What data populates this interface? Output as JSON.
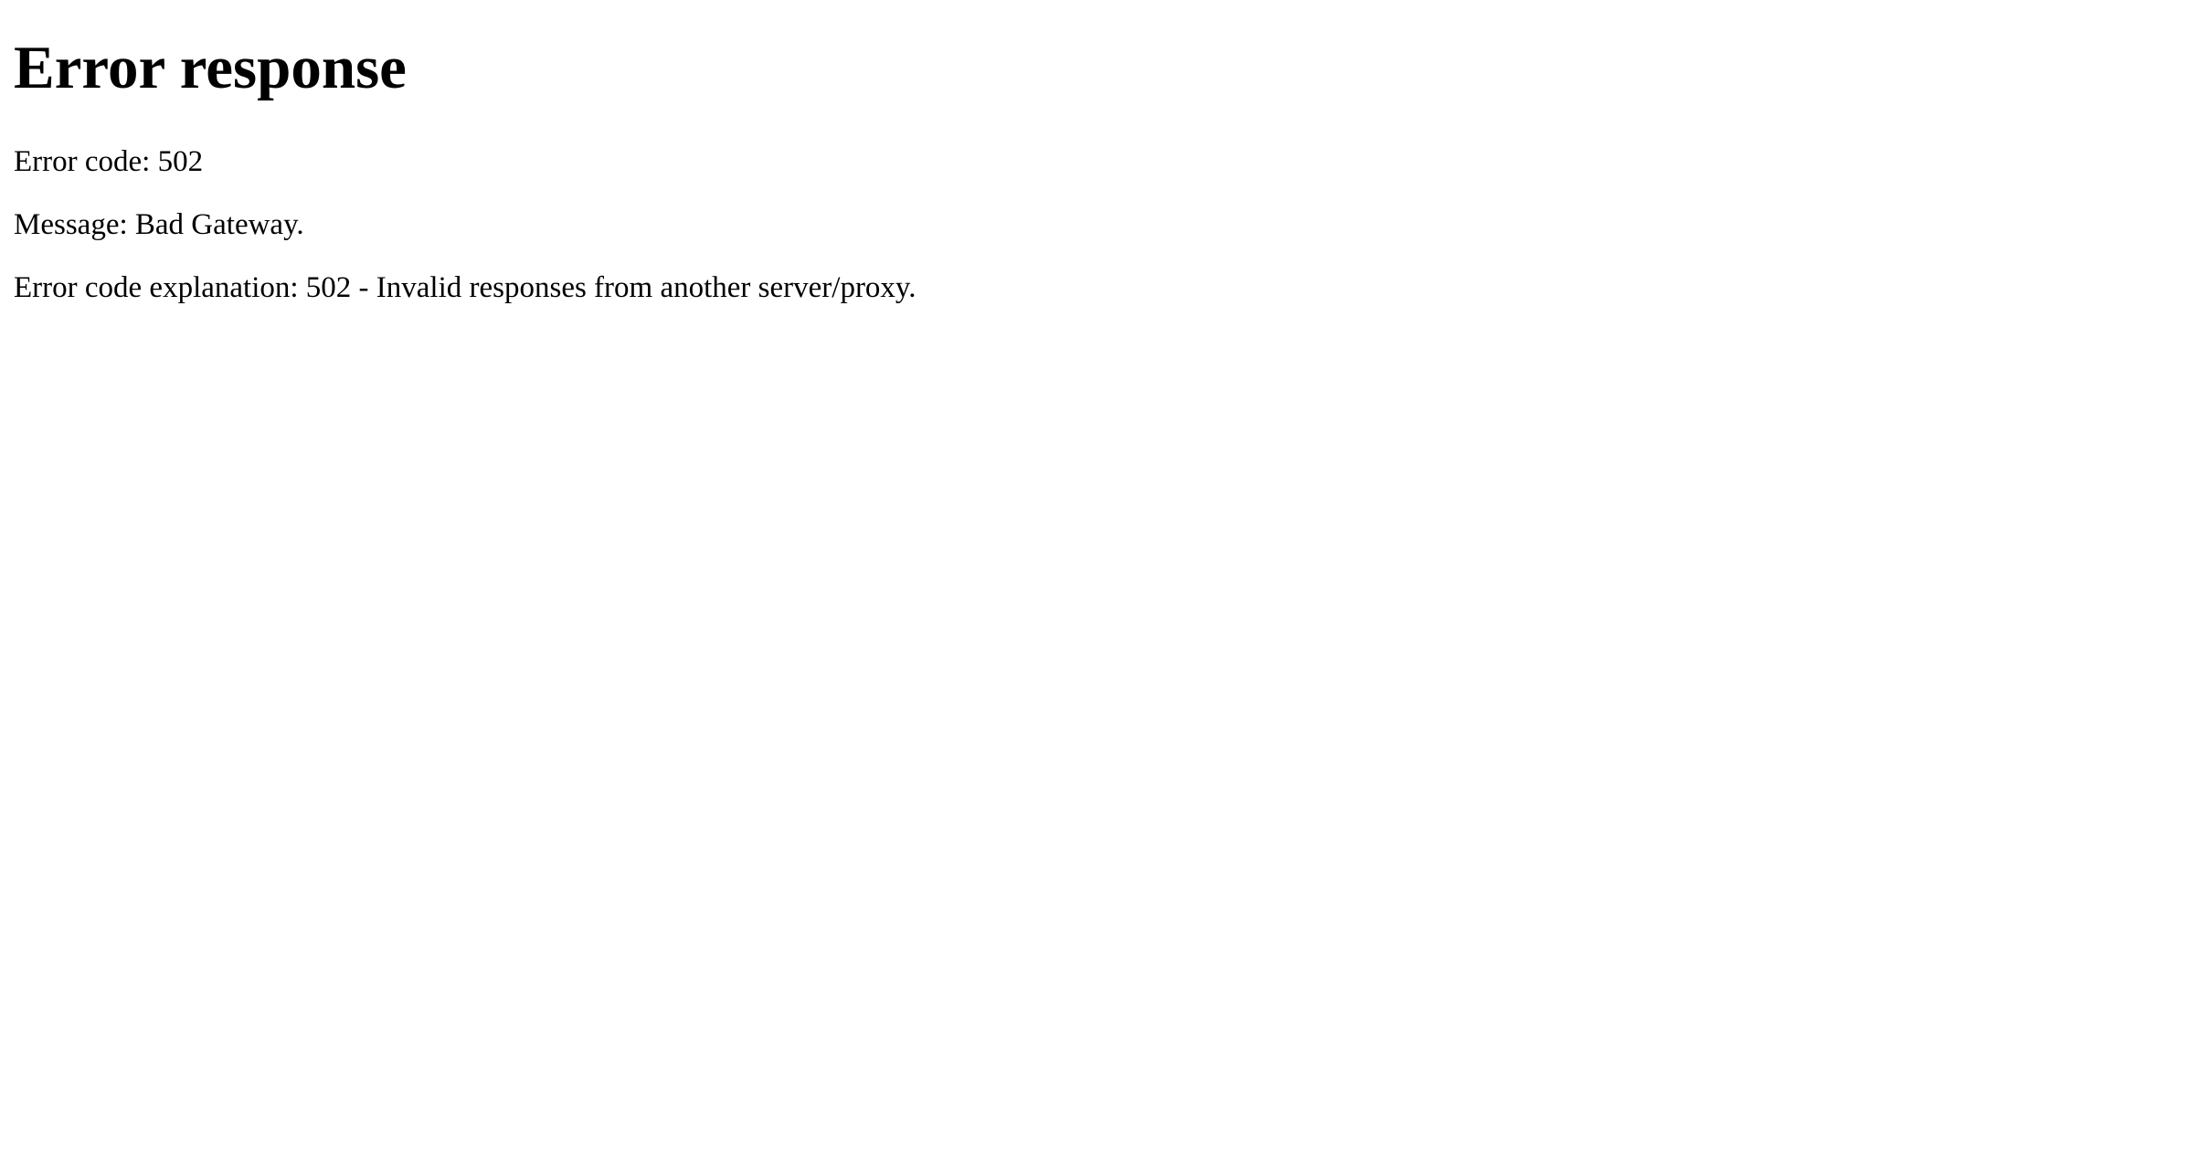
{
  "page": {
    "title": "Error response",
    "error_code_line": "Error code: 502",
    "message_line": "Message: Bad Gateway.",
    "explanation_line": "Error code explanation: 502 - Invalid responses from another server/proxy."
  }
}
